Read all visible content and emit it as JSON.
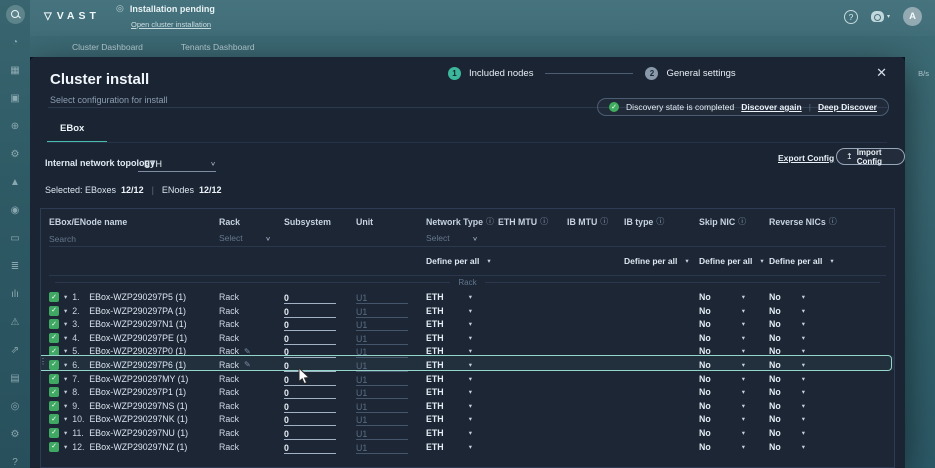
{
  "app": {
    "brand": "VAST",
    "status_text": "Installation pending",
    "status_link": "Open cluster installation",
    "nav_tabs": [
      "Cluster Dashboard",
      "Tenants Dashboard"
    ],
    "avatar_initial": "A",
    "right_edge_label": "B/s"
  },
  "sidebar": {
    "icons": [
      {
        "name": "search-icon",
        "glyph": "",
        "active": true
      },
      {
        "name": "history-icon",
        "glyph": "◔",
        "active": false
      },
      {
        "name": "dashboard-icon",
        "glyph": "▦",
        "active": false
      },
      {
        "name": "storage-icon",
        "glyph": "▣",
        "active": false
      },
      {
        "name": "network-globe-icon",
        "glyph": "⊕",
        "active": false
      },
      {
        "name": "services-gears-icon",
        "glyph": "⚙",
        "active": false
      },
      {
        "name": "security-shield-icon",
        "glyph": "▲",
        "active": false
      },
      {
        "name": "user-edit-icon",
        "glyph": "◉",
        "active": false
      },
      {
        "name": "api-brackets-icon",
        "glyph": "▭",
        "active": false
      },
      {
        "name": "database-icon",
        "glyph": "≣",
        "active": false
      },
      {
        "name": "analytics-bars-icon",
        "glyph": "ılı",
        "active": false
      },
      {
        "name": "alarms-triangle-icon",
        "glyph": "⚠",
        "active": false
      },
      {
        "name": "performance-arrows-icon",
        "glyph": "⇗",
        "active": false
      },
      {
        "name": "hardware-icon",
        "glyph": "▤",
        "active": false
      },
      {
        "name": "users-icon",
        "glyph": "◎",
        "active": false
      },
      {
        "name": "settings-gear-icon",
        "glyph": "⚙",
        "active": false
      },
      {
        "name": "help-icon",
        "glyph": "?",
        "active": false
      }
    ]
  },
  "modal": {
    "title": "Cluster install",
    "subtitle": "Select configuration for install",
    "close_glyph": "✕",
    "steps": [
      {
        "num": "1",
        "label": "Included nodes"
      },
      {
        "num": "2",
        "label": "General settings"
      }
    ],
    "discovery": {
      "message": "Discovery state is completed",
      "action1": "Discover again",
      "action2": "Deep Discover"
    },
    "tab_label": "EBox",
    "topology": {
      "label": "Internal network topology",
      "value": "ETH"
    },
    "actions": {
      "export": "Export Config",
      "import": "Import Config"
    },
    "selection": {
      "label1": "Selected: EBoxes",
      "value1": "12/12",
      "label2": "ENodes",
      "value2": "12/12"
    },
    "table": {
      "headers": [
        {
          "label": "EBox/ENode name",
          "info": false
        },
        {
          "label": "Rack",
          "info": false
        },
        {
          "label": "Subsystem",
          "info": false
        },
        {
          "label": "Unit",
          "info": false
        },
        {
          "label": "Network Type",
          "info": true
        },
        {
          "label": "ETH MTU",
          "info": true
        },
        {
          "label": "IB MTU",
          "info": true
        },
        {
          "label": "IB type",
          "info": true
        },
        {
          "label": "Skip NIC",
          "info": true
        },
        {
          "label": "Reverse NICs",
          "info": true
        }
      ],
      "search_placeholder": "Search",
      "select_placeholder": "Select",
      "define_per_all_label": "Define per all",
      "group_label": "Rack",
      "unit_placeholder": "U1",
      "rows": [
        {
          "num": "1.",
          "name": "EBox-WZP290297P5 (1)",
          "rack": "Rack",
          "subsystem": "0",
          "network": "ETH",
          "skip_nic": "No",
          "reverse_nics": "No",
          "rack_editable": false,
          "highlighted": false
        },
        {
          "num": "2.",
          "name": "EBox-WZP290297PA (1)",
          "rack": "Rack",
          "subsystem": "0",
          "network": "ETH",
          "skip_nic": "No",
          "reverse_nics": "No",
          "rack_editable": false,
          "highlighted": false
        },
        {
          "num": "3.",
          "name": "EBox-WZP290297N1 (1)",
          "rack": "Rack",
          "subsystem": "0",
          "network": "ETH",
          "skip_nic": "No",
          "reverse_nics": "No",
          "rack_editable": false,
          "highlighted": false
        },
        {
          "num": "4.",
          "name": "EBox-WZP290297PE (1)",
          "rack": "Rack",
          "subsystem": "0",
          "network": "ETH",
          "skip_nic": "No",
          "reverse_nics": "No",
          "rack_editable": false,
          "highlighted": false
        },
        {
          "num": "5.",
          "name": "EBox-WZP290297P0 (1)",
          "rack": "Rack",
          "subsystem": "0",
          "network": "ETH",
          "skip_nic": "No",
          "reverse_nics": "No",
          "rack_editable": true,
          "highlighted": false
        },
        {
          "num": "6.",
          "name": "EBox-WZP290297P6 (1)",
          "rack": "Rack",
          "subsystem": "0",
          "network": "ETH",
          "skip_nic": "No",
          "reverse_nics": "No",
          "rack_editable": true,
          "highlighted": true
        },
        {
          "num": "7.",
          "name": "EBox-WZP290297MY (1)",
          "rack": "Rack",
          "subsystem": "0",
          "network": "ETH",
          "skip_nic": "No",
          "reverse_nics": "No",
          "rack_editable": false,
          "highlighted": false
        },
        {
          "num": "8.",
          "name": "EBox-WZP290297P1 (1)",
          "rack": "Rack",
          "subsystem": "0",
          "network": "ETH",
          "skip_nic": "No",
          "reverse_nics": "No",
          "rack_editable": false,
          "highlighted": false
        },
        {
          "num": "9.",
          "name": "EBox-WZP290297NS (1)",
          "rack": "Rack",
          "subsystem": "0",
          "network": "ETH",
          "skip_nic": "No",
          "reverse_nics": "No",
          "rack_editable": false,
          "highlighted": false
        },
        {
          "num": "10.",
          "name": "EBox-WZP290297NK (1)",
          "rack": "Rack",
          "subsystem": "0",
          "network": "ETH",
          "skip_nic": "No",
          "reverse_nics": "No",
          "rack_editable": false,
          "highlighted": false
        },
        {
          "num": "11.",
          "name": "EBox-WZP290297NU (1)",
          "rack": "Rack",
          "subsystem": "0",
          "network": "ETH",
          "skip_nic": "No",
          "reverse_nics": "No",
          "rack_editable": false,
          "highlighted": false
        },
        {
          "num": "12.",
          "name": "EBox-WZP290297NZ (1)",
          "rack": "Rack",
          "subsystem": "0",
          "network": "ETH",
          "skip_nic": "No",
          "reverse_nics": "No",
          "rack_editable": false,
          "highlighted": false
        }
      ]
    }
  },
  "colors": {
    "accent_teal": "#49bdab",
    "checkbox_green": "#3fa963",
    "success_green": "#3fae5f",
    "modal_bg": "#1a2433",
    "topbar_bg": "#44717c"
  }
}
